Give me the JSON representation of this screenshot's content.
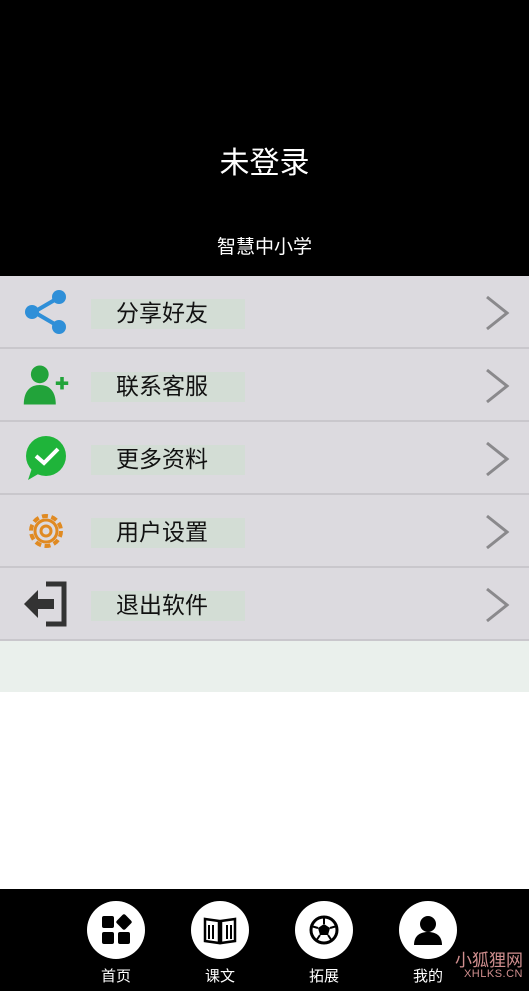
{
  "header": {
    "login_status": "未登录",
    "app_name": "智慧中小学"
  },
  "menu": [
    {
      "label": "分享好友",
      "icon": "share-icon",
      "color": "#2f8fd8"
    },
    {
      "label": "联系客服",
      "icon": "add-user-icon",
      "color": "#22a33a"
    },
    {
      "label": "更多资料",
      "icon": "wechat-icon",
      "color": "#1fb43a"
    },
    {
      "label": "用户设置",
      "icon": "gear-icon",
      "color": "#e08a22"
    },
    {
      "label": "退出软件",
      "icon": "exit-icon",
      "color": "#333333"
    }
  ],
  "tabbar": [
    {
      "label": "首页",
      "icon": "grid-icon"
    },
    {
      "label": "课文",
      "icon": "book-icon"
    },
    {
      "label": "拓展",
      "icon": "ball-icon"
    },
    {
      "label": "我的",
      "icon": "user-icon"
    }
  ],
  "watermark": {
    "text": "小狐狸网",
    "sub": "XHLKS.CN"
  }
}
